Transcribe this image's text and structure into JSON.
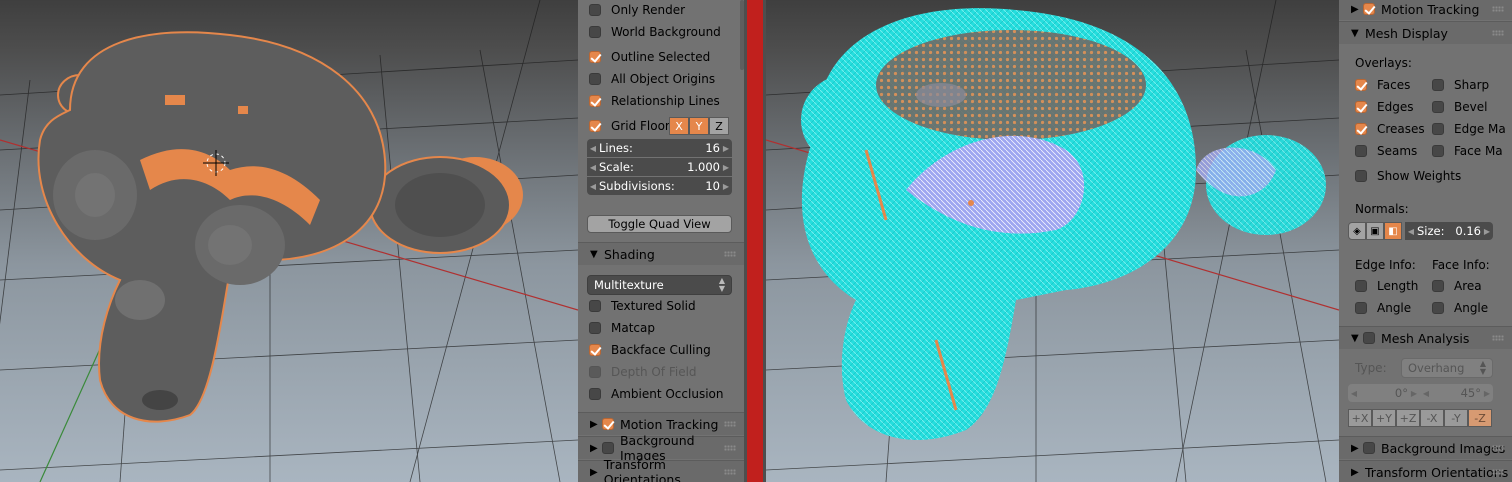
{
  "left_panel": {
    "display_options": [
      {
        "label": "Only Render",
        "checked": false
      },
      {
        "label": "World Background",
        "checked": false
      },
      {
        "label": "Outline Selected",
        "checked": true
      },
      {
        "label": "All Object Origins",
        "checked": false
      },
      {
        "label": "Relationship Lines",
        "checked": true
      },
      {
        "label": "Grid Floor",
        "checked": true
      }
    ],
    "grid_axes": [
      "X",
      "Y",
      "Z"
    ],
    "lines": {
      "label": "Lines:",
      "value": "16"
    },
    "scale": {
      "label": "Scale:",
      "value": "1.000"
    },
    "subdivisions": {
      "label": "Subdivisions:",
      "value": "10"
    },
    "toggle_quad_view": "Toggle Quad View",
    "shading": {
      "title": "Shading",
      "mode": "Multitexture",
      "options": [
        {
          "label": "Textured Solid",
          "checked": false,
          "disabled": false
        },
        {
          "label": "Matcap",
          "checked": false,
          "disabled": false
        },
        {
          "label": "Backface Culling",
          "checked": true,
          "disabled": false
        },
        {
          "label": "Depth Of Field",
          "checked": false,
          "disabled": true
        },
        {
          "label": "Ambient Occlusion",
          "checked": false,
          "disabled": false
        }
      ]
    },
    "sections": [
      {
        "title": "Motion Tracking",
        "checked": true
      },
      {
        "title": "Background Images",
        "checked": false
      },
      {
        "title": "Transform Orientations"
      }
    ]
  },
  "right_panel": {
    "motion_tracking": {
      "title": "Motion Tracking",
      "checked": true
    },
    "mesh_display": {
      "title": "Mesh Display",
      "overlays_label": "Overlays:",
      "overlays_left": [
        {
          "label": "Faces",
          "checked": true
        },
        {
          "label": "Edges",
          "checked": true
        },
        {
          "label": "Creases",
          "checked": true
        },
        {
          "label": "Seams",
          "checked": false
        }
      ],
      "overlays_right": [
        {
          "label": "Sharp",
          "checked": false
        },
        {
          "label": "Bevel",
          "checked": false
        },
        {
          "label": "Edge Ma",
          "checked": false
        },
        {
          "label": "Face Ma",
          "checked": false
        }
      ],
      "show_weights": {
        "label": "Show Weights",
        "checked": false
      },
      "normals_label": "Normals:",
      "normals_size": {
        "label": "Size:",
        "value": "0.16"
      },
      "edge_info_label": "Edge Info:",
      "face_info_label": "Face Info:",
      "edge_info": [
        {
          "label": "Length",
          "checked": false
        },
        {
          "label": "Angle",
          "checked": false
        }
      ],
      "face_info": [
        {
          "label": "Area",
          "checked": false
        },
        {
          "label": "Angle",
          "checked": false
        }
      ]
    },
    "mesh_analysis": {
      "title": "Mesh Analysis",
      "checked": false,
      "type_label": "Type:",
      "type_value": "Overhang",
      "min_value": "0°",
      "max_value": "45°",
      "axes": [
        "+X",
        "+Y",
        "+Z",
        "-X",
        "-Y",
        "-Z"
      ]
    },
    "sections": [
      {
        "title": "Background Images",
        "checked": false
      },
      {
        "title": "Transform Orientations"
      }
    ]
  },
  "colors": {
    "accent": "#e5874b",
    "panel_bg": "#727272",
    "normals": "#1ee0e0",
    "divider": "#c1201d"
  }
}
